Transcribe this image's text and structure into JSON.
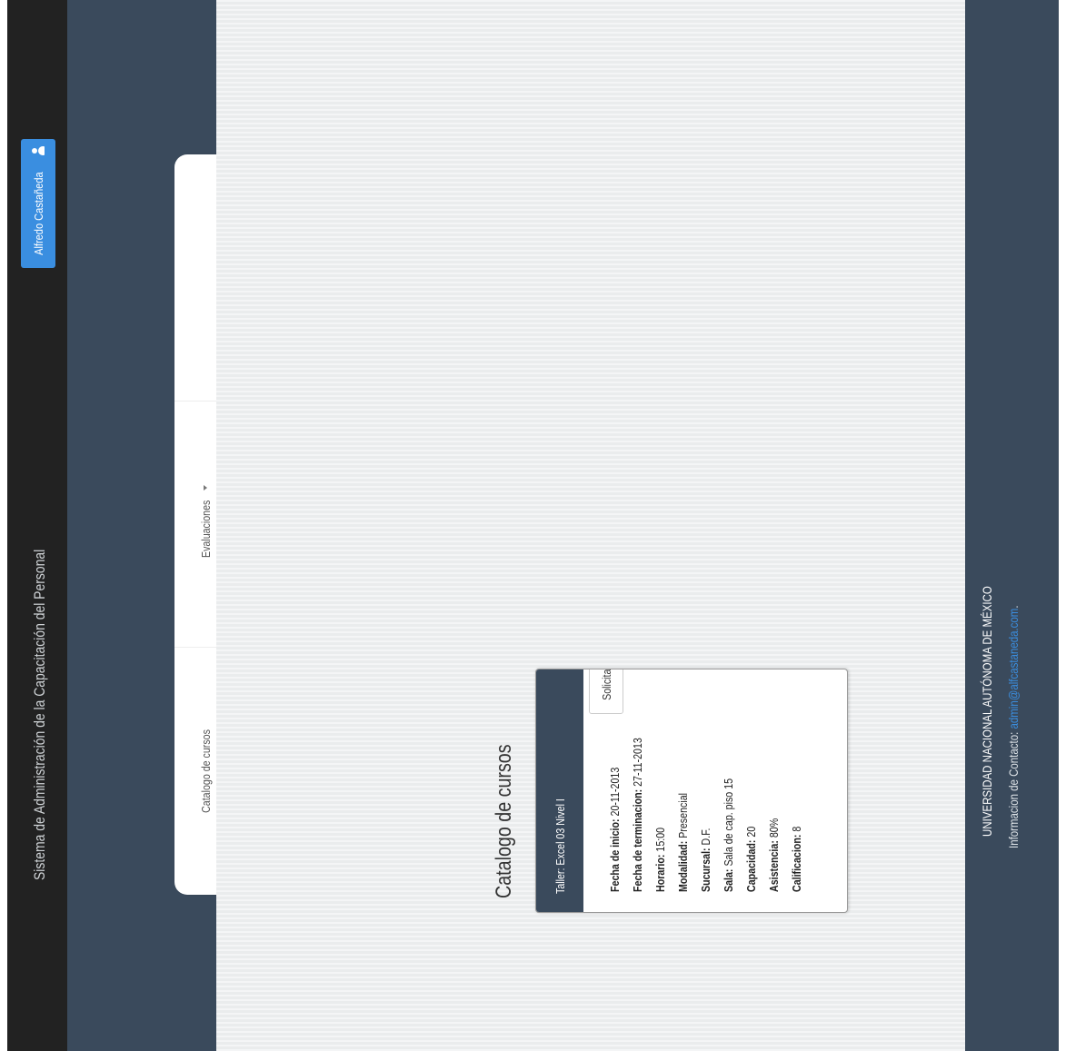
{
  "header": {
    "title": "Sistema de Administración de la Capacitación del Personal",
    "user_name": "Alfredo Castañeda",
    "user_icon": "user-icon"
  },
  "nav": {
    "items": [
      {
        "label": "Catalogo de cursos"
      },
      {
        "label": "Evaluaciones"
      }
    ],
    "dropdown_icon": "caret-down-icon"
  },
  "main": {
    "title": "Catalogo de cursos"
  },
  "course_card": {
    "header": "Taller: Excel 03 Nivel I",
    "fields": [
      {
        "label": "Fecha de inicio:",
        "value": " 20-11-2013"
      },
      {
        "label": "Fecha de terminacion:",
        "value": " 27-11-2013"
      },
      {
        "label": "Horario:",
        "value": " 15:00"
      },
      {
        "label": "Modalidad:",
        "value": " Presencial"
      },
      {
        "label": "Sucursal:",
        "value": " D.F."
      },
      {
        "label": "Sala:",
        "value": " Sala de cap. piso 15"
      },
      {
        "label": "Capacidad:",
        "value": " 20"
      },
      {
        "label": "Asistencia:",
        "value": " 80%"
      },
      {
        "label": "Calificacion:",
        "value": " 8"
      }
    ],
    "button_label": "Solicitar Inscripción"
  },
  "footer": {
    "institution": "UNIVERSIDAD NACIONAL AUTÓNOMA DE MÉXICO",
    "contact_label": "Informacion de Contacto: ",
    "contact_email": "admin@alfcastaneda.com",
    "contact_suffix": "."
  },
  "colors": {
    "topbar": "#222222",
    "nav_band": "#3a4a5c",
    "accent": "#3a8ee0",
    "content_bg": "#eef0f1"
  }
}
